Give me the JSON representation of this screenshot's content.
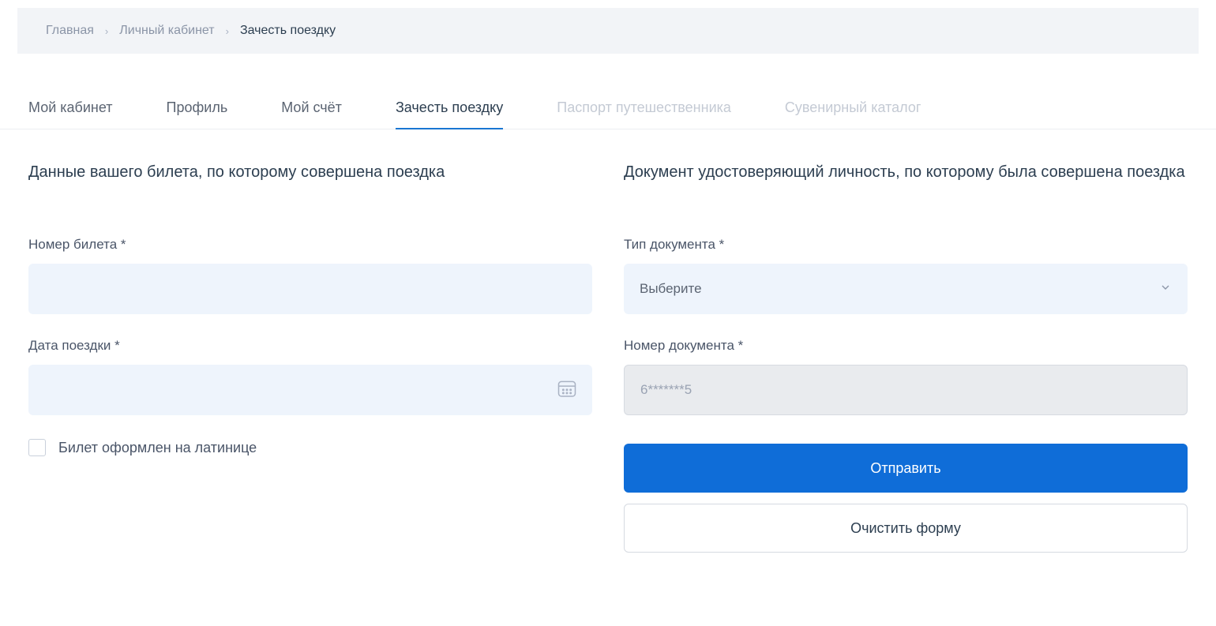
{
  "breadcrumbs": {
    "items": [
      {
        "label": "Главная"
      },
      {
        "label": "Личный кабинет"
      }
    ],
    "current": "Зачесть поездку"
  },
  "tabs": [
    {
      "label": "Мой кабинет",
      "active": false,
      "disabled": false
    },
    {
      "label": "Профиль",
      "active": false,
      "disabled": false
    },
    {
      "label": "Мой счёт",
      "active": false,
      "disabled": false
    },
    {
      "label": "Зачесть поездку",
      "active": true,
      "disabled": false
    },
    {
      "label": "Паспорт путешественника",
      "active": false,
      "disabled": true
    },
    {
      "label": "Сувенирный каталог",
      "active": false,
      "disabled": true
    }
  ],
  "left": {
    "section_title": "Данные вашего билета, по которому совершена поездка",
    "ticket_number_label": "Номер билета *",
    "ticket_number_value": "",
    "trip_date_label": "Дата поездки *",
    "trip_date_value": "",
    "latin_checkbox_label": "Билет оформлен на латинице"
  },
  "right": {
    "section_title": "Документ удостоверяющий личность, по которому была совершена поездка",
    "doc_type_label": "Тип документа *",
    "doc_type_selected": "Выберите",
    "doc_number_label": "Номер документа *",
    "doc_number_placeholder": "6*******5",
    "submit_label": "Отправить",
    "clear_label": "Очистить форму"
  }
}
